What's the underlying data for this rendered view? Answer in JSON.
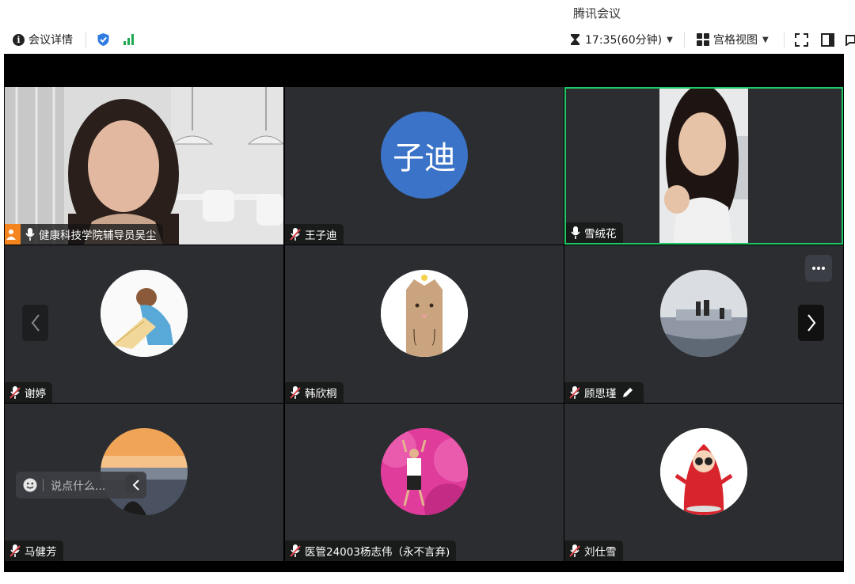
{
  "app": {
    "title": "腾讯会议"
  },
  "toolbar": {
    "meeting_info_label": "会议详情",
    "timer": "17:35(60分钟)",
    "view_label": "宫格视图"
  },
  "colors": {
    "active_speaker_border": "#1fc765",
    "host_badge": "#f5841f",
    "tile_bg": "#2b2d31",
    "signal": "#1fa84f",
    "shield": "#2f7de1"
  },
  "participants": [
    {
      "name": "健康科技学院辅导员吴尘",
      "mic": "on",
      "host": true,
      "video": "on"
    },
    {
      "name": "王子迪",
      "mic": "muted",
      "video": "off",
      "avatar_text": "子迪"
    },
    {
      "name": "雪绒花",
      "mic": "on",
      "video": "on",
      "active_speaker": true
    },
    {
      "name": "谢婷",
      "mic": "muted",
      "video": "off"
    },
    {
      "name": "韩欣桐",
      "mic": "muted",
      "video": "off"
    },
    {
      "name": "顾思瑾",
      "mic": "muted",
      "video": "off",
      "annotating": true
    },
    {
      "name": "马健芳",
      "mic": "muted",
      "video": "off"
    },
    {
      "name": "医管24003杨志伟（永不言弃)",
      "mic": "muted",
      "video": "off"
    },
    {
      "name": "刘仕雪",
      "mic": "muted",
      "video": "off"
    }
  ],
  "chat": {
    "placeholder": "说点什么..."
  },
  "icons": [
    "info-icon",
    "shield-check-icon",
    "signal-icon",
    "hourglass-icon",
    "grid-view-icon",
    "fullscreen-icon",
    "sidebar-icon",
    "mic-icon",
    "mic-muted-icon",
    "person-icon",
    "pencil-icon",
    "chevron-left-icon",
    "chevron-right-icon",
    "more-icon",
    "emoji-icon"
  ]
}
